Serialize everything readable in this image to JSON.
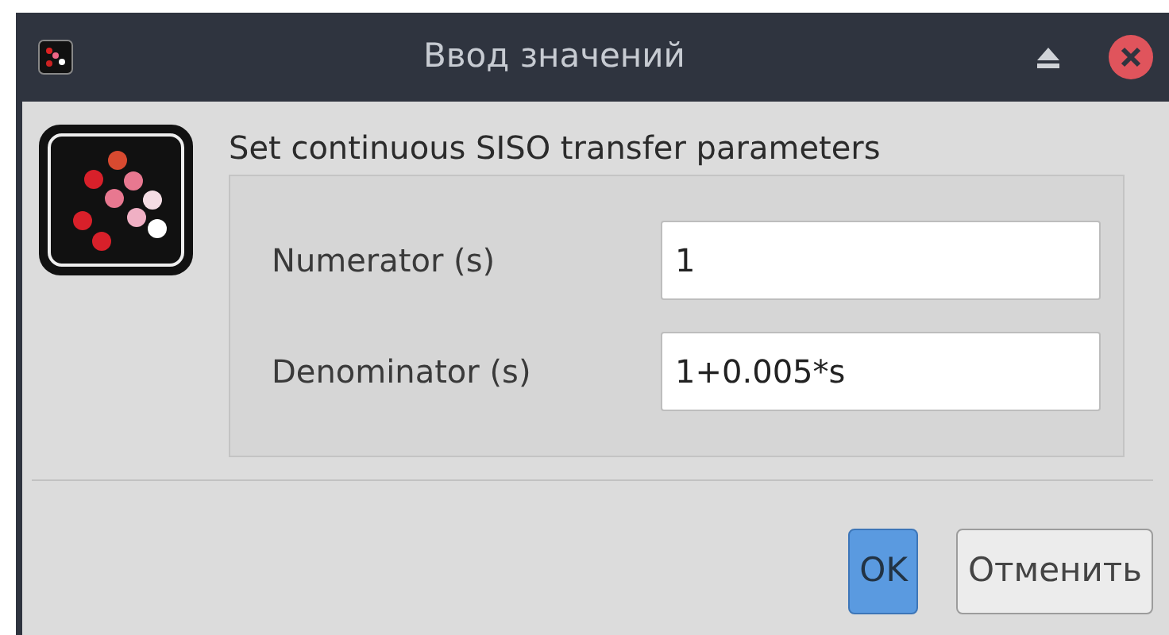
{
  "window": {
    "title": "Ввод значений"
  },
  "heading": "Set continuous SISO transfer parameters",
  "fields": [
    {
      "label": "Numerator (s)",
      "value": "1"
    },
    {
      "label": "Denominator (s)",
      "value": "1+0.005*s"
    }
  ],
  "buttons": [
    {
      "label": "OK",
      "selected": true
    },
    {
      "label": "Отменить",
      "selected": false
    }
  ]
}
